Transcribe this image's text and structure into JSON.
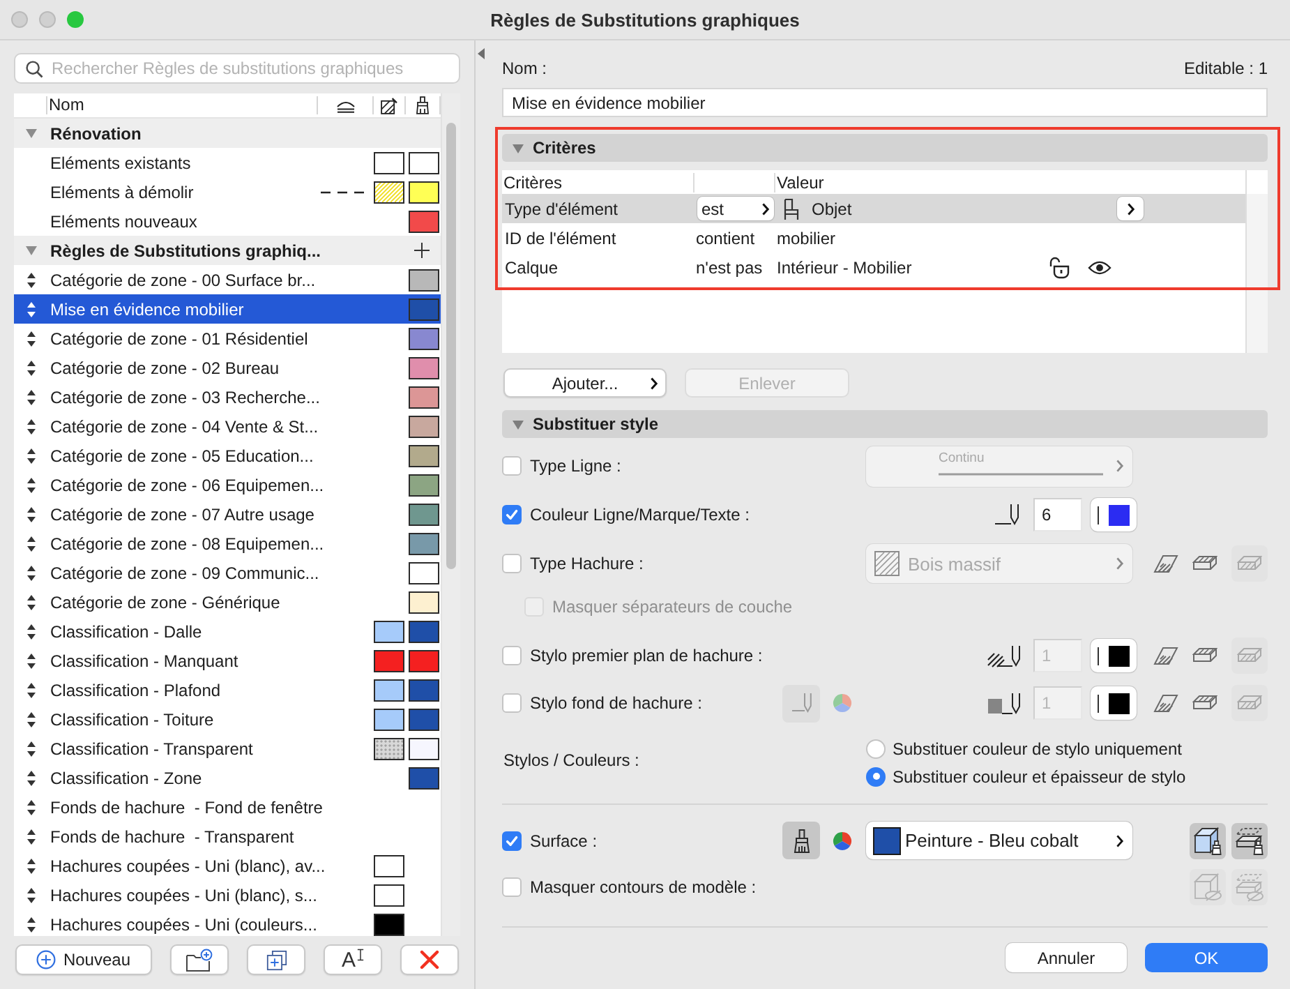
{
  "window": {
    "title": "Règles de Substitutions graphiques",
    "controls": [
      {
        "kind": "close",
        "enabled": false
      },
      {
        "kind": "minimize",
        "enabled": false
      },
      {
        "kind": "zoom",
        "enabled": true
      }
    ]
  },
  "sidebar": {
    "search": {
      "placeholder": "Rechercher Règles de substitutions graphiques"
    },
    "name_column": "Nom",
    "groups": [
      {
        "name": "Rénovation",
        "expanded": true,
        "reorderable": false,
        "add_button": false,
        "items": [
          {
            "name": "Eléments existants",
            "selected": false,
            "hatch": {
              "color": "#ffffff",
              "kind": "solid"
            },
            "surface": {
              "color": "#ffffff"
            }
          },
          {
            "name": "Eléments à démolir",
            "selected": false,
            "dashed_line": true,
            "hatch": {
              "color": "#f2e23a",
              "kind": "diagonal"
            },
            "surface": {
              "color": "#ffff55"
            }
          },
          {
            "name": "Eléments nouveaux",
            "selected": false,
            "surface": {
              "color": "#f24a4a"
            }
          }
        ]
      },
      {
        "name": "Règles de Substitutions graphiq...",
        "expanded": true,
        "reorderable": true,
        "add_button": true,
        "items": [
          {
            "name": "Catégorie de zone - 00 Surface br...",
            "selected": false,
            "surface": {
              "color": "#b8b8b8"
            }
          },
          {
            "name": "Mise en évidence mobilier",
            "selected": true,
            "surface": {
              "color": "#1f4fa8"
            }
          },
          {
            "name": "Catégorie de zone - 01 Résidentiel",
            "selected": false,
            "surface": {
              "color": "#8888d0"
            }
          },
          {
            "name": "Catégorie de zone - 02 Bureau",
            "selected": false,
            "surface": {
              "color": "#e08eac"
            }
          },
          {
            "name": "Catégorie de zone - 03 Recherche...",
            "selected": false,
            "surface": {
              "color": "#dc9696"
            }
          },
          {
            "name": "Catégorie de zone - 04 Vente & St...",
            "selected": false,
            "surface": {
              "color": "#c8a89e"
            }
          },
          {
            "name": "Catégorie de zone - 05 Education...",
            "selected": false,
            "surface": {
              "color": "#b2aa8c"
            }
          },
          {
            "name": "Catégorie de zone - 06 Equipemen...",
            "selected": false,
            "surface": {
              "color": "#8ca583"
            }
          },
          {
            "name": "Catégorie de zone - 07 Autre usage",
            "selected": false,
            "surface": {
              "color": "#6f978f"
            }
          },
          {
            "name": "Catégorie de zone - 08 Equipemen...",
            "selected": false,
            "surface": {
              "color": "#7899a9"
            }
          },
          {
            "name": "Catégorie de zone - 09 Communic...",
            "selected": false,
            "surface": {
              "color": "#ffffff"
            }
          },
          {
            "name": "Catégorie de zone - Générique",
            "selected": false,
            "surface": {
              "color": "#fdf0d0"
            }
          },
          {
            "name": "Classification - Dalle",
            "selected": false,
            "hatch": {
              "color": "#a6cbfa",
              "kind": "solid"
            },
            "surface": {
              "color": "#1f4fa8"
            }
          },
          {
            "name": "Classification - Manquant",
            "selected": false,
            "hatch": {
              "color": "#f42020",
              "kind": "solid"
            },
            "surface": {
              "color": "#f42020"
            }
          },
          {
            "name": "Classification - Plafond",
            "selected": false,
            "hatch": {
              "color": "#a6cbfa",
              "kind": "solid"
            },
            "surface": {
              "color": "#1f4fa8"
            }
          },
          {
            "name": "Classification - Toiture",
            "selected": false,
            "hatch": {
              "color": "#a6cbfa",
              "kind": "solid"
            },
            "surface": {
              "color": "#1f4fa8"
            }
          },
          {
            "name": "Classification - Transparent",
            "selected": false,
            "hatch": {
              "color": "#d8d8d8",
              "kind": "dotted"
            },
            "surface": {
              "color": "#f6f6fe"
            }
          },
          {
            "name": "Classification - Zone",
            "selected": false,
            "surface": {
              "color": "#1f4fa8"
            }
          },
          {
            "name": "Fonds de hachure  - Fond de fenêtre",
            "selected": false
          },
          {
            "name": "Fonds de hachure  - Transparent",
            "selected": false
          },
          {
            "name": "Hachures coupées - Uni (blanc), av...",
            "selected": false,
            "hatch": {
              "color": "#ffffff",
              "kind": "solid"
            }
          },
          {
            "name": "Hachures coupées - Uni (blanc), s...",
            "selected": false,
            "hatch": {
              "color": "#ffffff",
              "kind": "solid"
            }
          },
          {
            "name": "Hachures coupées - Uni (couleurs...",
            "selected": false,
            "hatch": {
              "color": "#000000",
              "kind": "solid"
            }
          }
        ]
      }
    ],
    "buttons": [
      {
        "kind": "new",
        "label": "Nouveau"
      },
      {
        "kind": "new-folder"
      },
      {
        "kind": "duplicate"
      },
      {
        "kind": "rename",
        "label": "A"
      },
      {
        "kind": "delete"
      }
    ]
  },
  "editor": {
    "name_label": "Nom :",
    "editable": "Editable : 1",
    "name_value": "Mise en évidence mobilier",
    "criteria": {
      "title": "Critères",
      "expanded": true,
      "highlighted": true,
      "columns": {
        "criterion": "Critères",
        "value": "Valeur"
      },
      "rows": [
        {
          "kind": "element-type",
          "criterion": "Type d'élément",
          "operator": "est",
          "value": "Objet",
          "selected": true
        },
        {
          "kind": "text",
          "criterion": "ID de l'élément",
          "operator": "contient",
          "value": "mobilier",
          "selected": false
        },
        {
          "kind": "layer",
          "criterion": "Calque",
          "operator": "n'est pas",
          "value": "Intérieur - Mobilier",
          "selected": false
        }
      ]
    },
    "criteria_buttons": [
      {
        "kind": "menu",
        "label": "Ajouter...",
        "disabled": false
      },
      {
        "kind": "plain",
        "label": "Enlever",
        "disabled": true
      }
    ],
    "style": {
      "title": "Substituer style",
      "expanded": true,
      "rows": [
        {
          "kind": "line-type",
          "label": "Type Ligne :",
          "checked": false,
          "line_type": "Continu"
        },
        {
          "kind": "pen-color",
          "label": "Couleur Ligne/Marque/Texte :",
          "checked": true,
          "pen": "6",
          "color": "#2b2cf2"
        },
        {
          "kind": "fill-type",
          "label": "Type Hachure :",
          "checked": false,
          "fill_type": "Bois massif"
        },
        {
          "kind": "sub-option",
          "label": "Masquer séparateurs de couche",
          "checked": false,
          "disabled": true
        },
        {
          "kind": "fill-pen",
          "label": "Stylo premier plan de hachure :",
          "checked": false,
          "pen": "1",
          "color": "#000000"
        },
        {
          "kind": "fill-bg-pen",
          "label": "Stylo fond de hachure :",
          "checked": false,
          "pen": "1",
          "color": "#000000"
        },
        {
          "kind": "radio-group",
          "label": "Stylos / Couleurs :",
          "options": [
            {
              "label": "Substituer couleur de stylo uniquement",
              "selected": false
            },
            {
              "label": "Substituer couleur et épaisseur de stylo",
              "selected": true
            }
          ]
        },
        {
          "kind": "surface",
          "label": "Surface :",
          "checked": true,
          "surface": "Peinture - Bleu cobalt",
          "color": "#1f4fa8"
        },
        {
          "kind": "hide-contours",
          "label": "Masquer contours de modèle :",
          "checked": false
        }
      ]
    },
    "footer": {
      "cancel": "Annuler",
      "ok": "OK"
    }
  }
}
